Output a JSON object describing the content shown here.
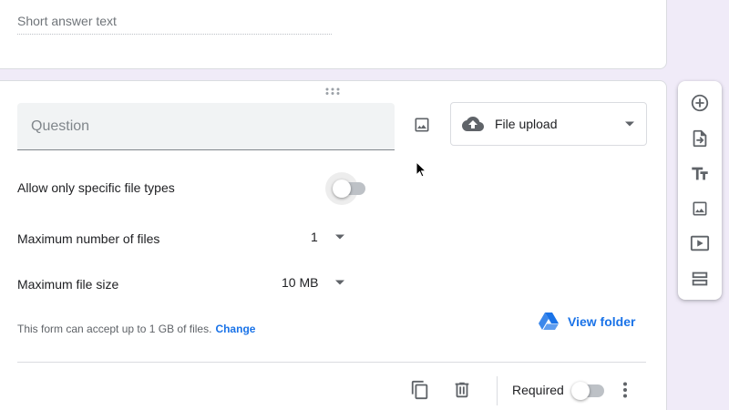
{
  "previous_question": {
    "answer_placeholder": "Short answer text"
  },
  "question": {
    "placeholder": "Question",
    "value": ""
  },
  "question_type": {
    "selected": "File upload",
    "icon": "cloud-upload-icon"
  },
  "settings": {
    "specific_types_label": "Allow only specific file types",
    "specific_types_enabled": false,
    "max_files_label": "Maximum number of files",
    "max_files_value": "1",
    "max_size_label": "Maximum file size",
    "max_size_value": "10 MB"
  },
  "note": {
    "text": "This form can accept up to 1 GB of files.",
    "link": "Change"
  },
  "drive": {
    "view_folder": "View folder"
  },
  "footer": {
    "required_label": "Required",
    "required_enabled": false
  },
  "toolbar": {
    "items": [
      "add-question-icon",
      "import-questions-icon",
      "add-title-icon",
      "add-image-icon",
      "add-video-icon",
      "add-section-icon"
    ]
  },
  "colors": {
    "background": "#f0ebf8",
    "accent": "#1a73e8",
    "icon": "#5f6368"
  }
}
